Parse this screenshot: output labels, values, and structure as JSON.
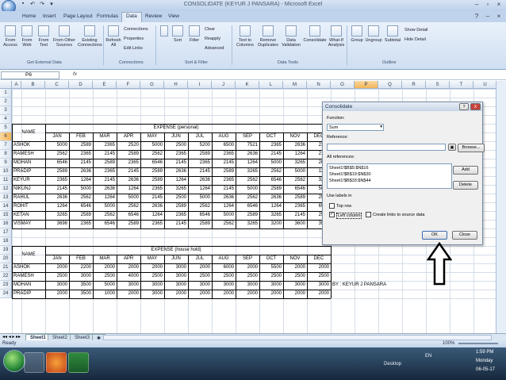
{
  "window": {
    "title": "CONSOLIDATE (KEYUR J PANSARA) - Microsoft Excel"
  },
  "tabs": [
    "Home",
    "Insert",
    "Page Layout",
    "Formulas",
    "Data",
    "Review",
    "View"
  ],
  "ribbon": {
    "buttons": [
      "From Access",
      "From Web",
      "From Text",
      "From Other Sources",
      "Existing Connections",
      "Refresh All",
      "Connections",
      "Properties",
      "Edit Links",
      "Sort",
      "Filter",
      "Clear",
      "Reapply",
      "Advanced",
      "Text to Columns",
      "Remove Duplicates",
      "Data Validation",
      "Consolidate",
      "What-If Analysis",
      "Group",
      "Ungroup",
      "Subtotal",
      "Show Detail",
      "Hide Detail"
    ],
    "groups": [
      "Get External Data",
      "Connections",
      "Sort & Filter",
      "Data Tools",
      "Outline"
    ]
  },
  "formula_bar": {
    "name_box": "P6",
    "fx": "fx"
  },
  "columns": [
    "A",
    "B",
    "C",
    "D",
    "E",
    "F",
    "G",
    "H",
    "I",
    "J",
    "K",
    "L",
    "M",
    "N",
    "O",
    "P",
    "Q",
    "R",
    "S",
    "T",
    "U"
  ],
  "rows": [
    "1",
    "2",
    "3",
    "4",
    "5",
    "6",
    "7",
    "8",
    "9",
    "10",
    "11",
    "12",
    "13",
    "14",
    "15",
    "16",
    "17",
    "18",
    "19",
    "20",
    "21",
    "22",
    "23",
    "24"
  ],
  "table1": {
    "title": "EXPENSE (personal)",
    "name_header": "NAME",
    "months": [
      "JAN",
      "FEB",
      "MAR",
      "APR",
      "MAY",
      "JUN",
      "JUL",
      "AUG",
      "SEP",
      "OCT",
      "NOV",
      "DEC"
    ],
    "rows": [
      {
        "name": "ASHOK",
        "v": [
          "5000",
          "2589",
          "2365",
          "2520",
          "5000",
          "2500",
          "5200",
          "6500",
          "7521",
          "2365",
          "2636",
          "2365"
        ]
      },
      {
        "name": "RAMESH",
        "v": [
          "2562",
          "2365",
          "2145",
          "2589",
          "2562",
          "2365",
          "2589",
          "2365",
          "2636",
          "2145",
          "1264",
          "2145"
        ]
      },
      {
        "name": "MOHAN",
        "v": [
          "6546",
          "2145",
          "2589",
          "2365",
          "6546",
          "2145",
          "2365",
          "2145",
          "1264",
          "5000",
          "3265",
          "2636"
        ]
      },
      {
        "name": "PRADIP",
        "v": [
          "2589",
          "2636",
          "2365",
          "2145",
          "2589",
          "2636",
          "2145",
          "2589",
          "3265",
          "2562",
          "5000",
          "1264"
        ]
      },
      {
        "name": "KEYUR",
        "v": [
          "2365",
          "1264",
          "2145",
          "2636",
          "2589",
          "1264",
          "2636",
          "2365",
          "2562",
          "6546",
          "2562",
          "3265"
        ]
      },
      {
        "name": "NIKUNJ",
        "v": [
          "2145",
          "5000",
          "2636",
          "1264",
          "2365",
          "3265",
          "1264",
          "2145",
          "5000",
          "2589",
          "6546",
          "5000"
        ]
      },
      {
        "name": "RAHUL",
        "v": [
          "2636",
          "2562",
          "1264",
          "5000",
          "2145",
          "2500",
          "5000",
          "2636",
          "2562",
          "2636",
          "2589",
          "2562"
        ]
      },
      {
        "name": "ROHIT",
        "v": [
          "1264",
          "6546",
          "5000",
          "2562",
          "2636",
          "2589",
          "2562",
          "1264",
          "6546",
          "1264",
          "2365",
          "6546"
        ]
      },
      {
        "name": "KETAN",
        "v": [
          "3265",
          "2589",
          "2562",
          "6546",
          "1264",
          "2365",
          "6546",
          "5000",
          "2589",
          "3265",
          "2145",
          "2589"
        ]
      },
      {
        "name": "VISMAY",
        "v": [
          "3698",
          "2365",
          "6546",
          "2589",
          "2365",
          "2145",
          "2589",
          "2562",
          "3265",
          "3200",
          "3600",
          "3956"
        ]
      }
    ]
  },
  "table2": {
    "title": "EXPENSE (house hold)",
    "name_header": "NAME",
    "months": [
      "JAN",
      "FEB",
      "MAR",
      "APR",
      "MAY",
      "JUN",
      "JUL",
      "AUG",
      "SEP",
      "OCT",
      "NOV",
      "DEC"
    ],
    "rows": [
      {
        "name": "ASHOK",
        "v": [
          "2000",
          "2200",
          "2000",
          "2000",
          "2000",
          "3000",
          "2000",
          "6000",
          "2000",
          "5500",
          "2000",
          "2000"
        ]
      },
      {
        "name": "RAMESH",
        "v": [
          "2500",
          "3000",
          "2500",
          "4000",
          "2500",
          "3000",
          "2500",
          "2500",
          "2500",
          "2500",
          "2500",
          "2500"
        ]
      },
      {
        "name": "MOHAN",
        "v": [
          "3000",
          "3500",
          "5000",
          "3000",
          "3000",
          "3000",
          "3000",
          "3000",
          "3000",
          "3000",
          "3000",
          "3000"
        ]
      },
      {
        "name": "PRADIP",
        "v": [
          "2000",
          "3500",
          "1000",
          "2000",
          "3000",
          "2000",
          "2000",
          "2000",
          "2000",
          "2000",
          "2000",
          "2000"
        ]
      }
    ]
  },
  "byline": "BY : KEYUR J PANSARA",
  "dialog": {
    "title": "Consolidate",
    "function_label": "Function:",
    "function_value": "Sum",
    "reference_label": "Reference:",
    "reference_value": "",
    "browse": "Browse...",
    "all_refs_label": "All references:",
    "refs": [
      "Sheet1!$B$5:$N$16",
      "Sheet1!$B$19:$N$30",
      "Sheet1!$B$33:$N$44"
    ],
    "add": "Add",
    "delete": "Delete",
    "use_labels": "Use labels in",
    "top_row": "Top row",
    "left_column": "Left column",
    "create_links": "Create links to source data",
    "ok": "OK",
    "close": "Close",
    "help": "?",
    "x": "X"
  },
  "sheet_tabs": [
    "Sheet1",
    "Sheet2",
    "Sheet3"
  ],
  "status": {
    "text": "Ready",
    "zoom": "100%"
  },
  "taskbar": {
    "desktop": "Desktop",
    "lang": "EN",
    "time": "1:59 PM",
    "day": "Monday",
    "date": "06-05-17"
  }
}
